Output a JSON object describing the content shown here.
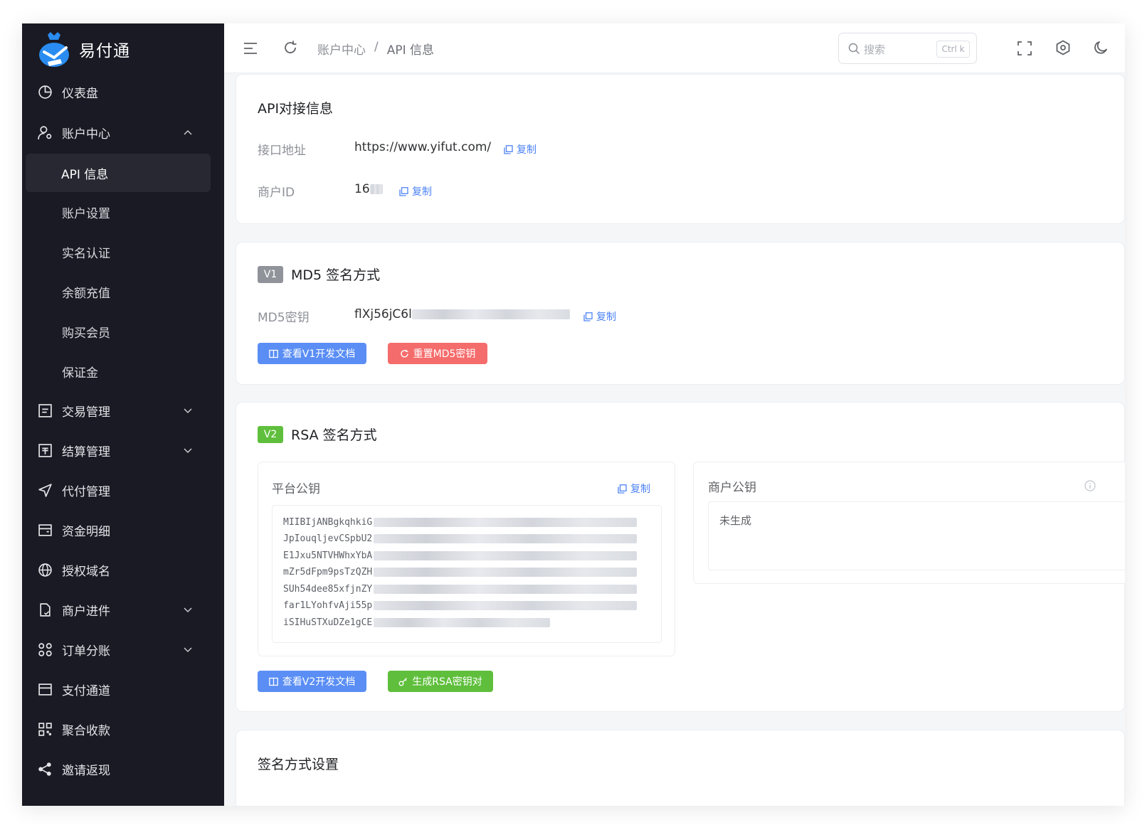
{
  "app": {
    "name": "易付通"
  },
  "sidebar": {
    "items": [
      {
        "label": "仪表盘",
        "icon": "dashboard-icon"
      },
      {
        "label": "账户中心",
        "icon": "user-settings-icon",
        "expanded": true
      },
      {
        "label": "交易管理",
        "icon": "order-list-icon"
      },
      {
        "label": "结算管理",
        "icon": "settlement-icon"
      },
      {
        "label": "代付管理",
        "icon": "send-icon"
      },
      {
        "label": "资金明细",
        "icon": "wallet-icon"
      },
      {
        "label": "授权域名",
        "icon": "globe-icon"
      },
      {
        "label": "商户进件",
        "icon": "document-icon"
      },
      {
        "label": "订单分账",
        "icon": "split-icon"
      },
      {
        "label": "支付通道",
        "icon": "card-icon"
      },
      {
        "label": "聚合收款",
        "icon": "qrcode-icon"
      },
      {
        "label": "邀请返现",
        "icon": "share-icon"
      }
    ],
    "account_sub": [
      {
        "label": "API 信息",
        "active": true
      },
      {
        "label": "账户设置"
      },
      {
        "label": "实名认证"
      },
      {
        "label": "余额充值"
      },
      {
        "label": "购买会员"
      },
      {
        "label": "保证金"
      }
    ]
  },
  "header": {
    "breadcrumb": [
      "账户中心",
      "API 信息"
    ],
    "breadcrumb_sep": "/",
    "search_placeholder": "搜索",
    "search_shortcut": "Ctrl k"
  },
  "api_card": {
    "title": "API对接信息",
    "endpoint_label": "接口地址",
    "endpoint_value": "https://www.yifut.com/",
    "merchant_label": "商户ID",
    "merchant_value": "16",
    "copy_label": "复制"
  },
  "md5_card": {
    "tag": "V1",
    "title": "MD5 签名方式",
    "key_label": "MD5密钥",
    "key_value": "flXj56jC6l",
    "copy_label": "复制",
    "doc_button": "查看V1开发文档",
    "reset_button": "重置MD5密钥"
  },
  "rsa_card": {
    "tag": "V2",
    "title": "RSA 签名方式",
    "platform_key_title": "平台公钥",
    "copy_label": "复制",
    "platform_key_lines": [
      "MIIBIjANBgkqhkiG",
      "JpIouqljevCSpbU2",
      "E1Jxu5NTVHWhxYbA",
      "mZr5dFpm9psTzQZH",
      "SUh54dee85xfjnZY",
      "far1LYohfvAji55p",
      "iSIHuSTXuDZe1gCE"
    ],
    "merchant_key_title": "商户公钥",
    "merchant_key_value": "未生成",
    "doc_button": "查看V2开发文档",
    "generate_button": "生成RSA密钥对"
  },
  "sign_card": {
    "title": "签名方式设置"
  },
  "colors": {
    "sidebar_bg": "#191a23",
    "primary": "#4d83f5",
    "danger": "#f56c6c",
    "success": "#5fbf3c",
    "tag_gray": "#909399"
  }
}
